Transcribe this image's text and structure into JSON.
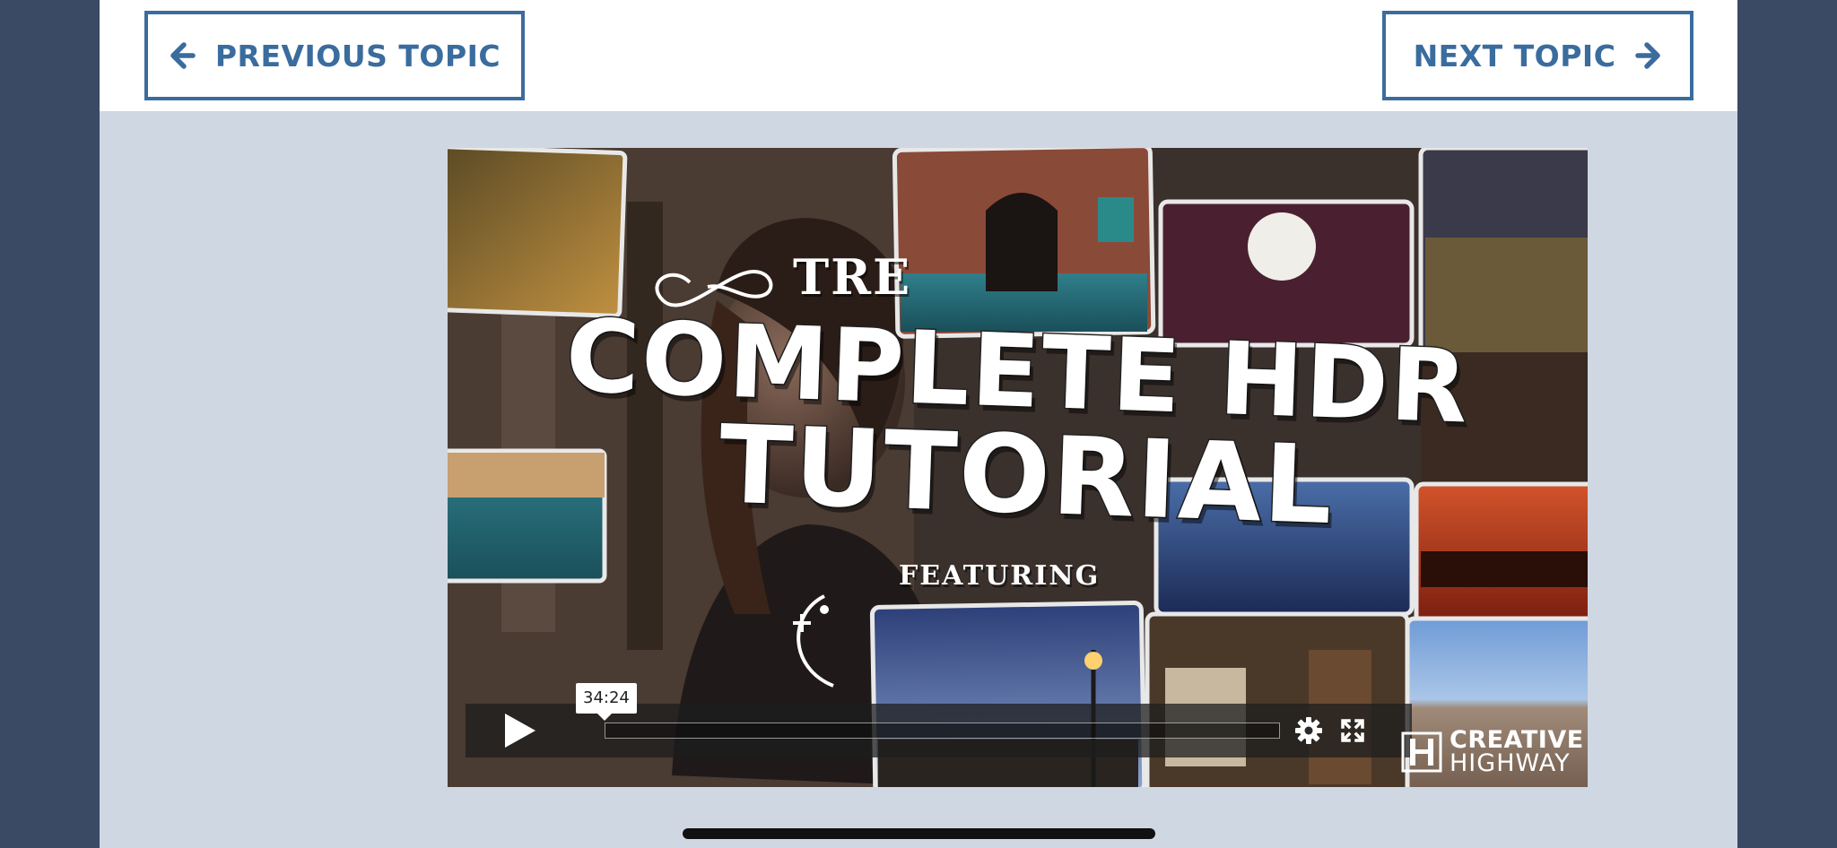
{
  "nav": {
    "prev_label": "PREVIOUS TOPIC",
    "next_label": "NEXT TOPIC"
  },
  "video": {
    "title_prefix": "TRE",
    "title_line1": "COMPLETE HDR",
    "title_line2": "TUTORIAL",
    "subtitle": "FEATURING",
    "time_tooltip": "34:24",
    "progress": 0.0,
    "logo_line1": "CREATIVE",
    "logo_line2": "HIGHWAY"
  },
  "colors": {
    "brand_blue": "#3a6c9e",
    "outer_bg": "#3a4a65",
    "page_bg": "#cfd7e2"
  },
  "icons": {
    "prev": "arrow-left-icon",
    "next": "arrow-right-icon",
    "play": "play-icon",
    "settings": "gear-icon",
    "fullscreen": "fullscreen-icon",
    "logo": "creative-highway-logo-icon"
  }
}
